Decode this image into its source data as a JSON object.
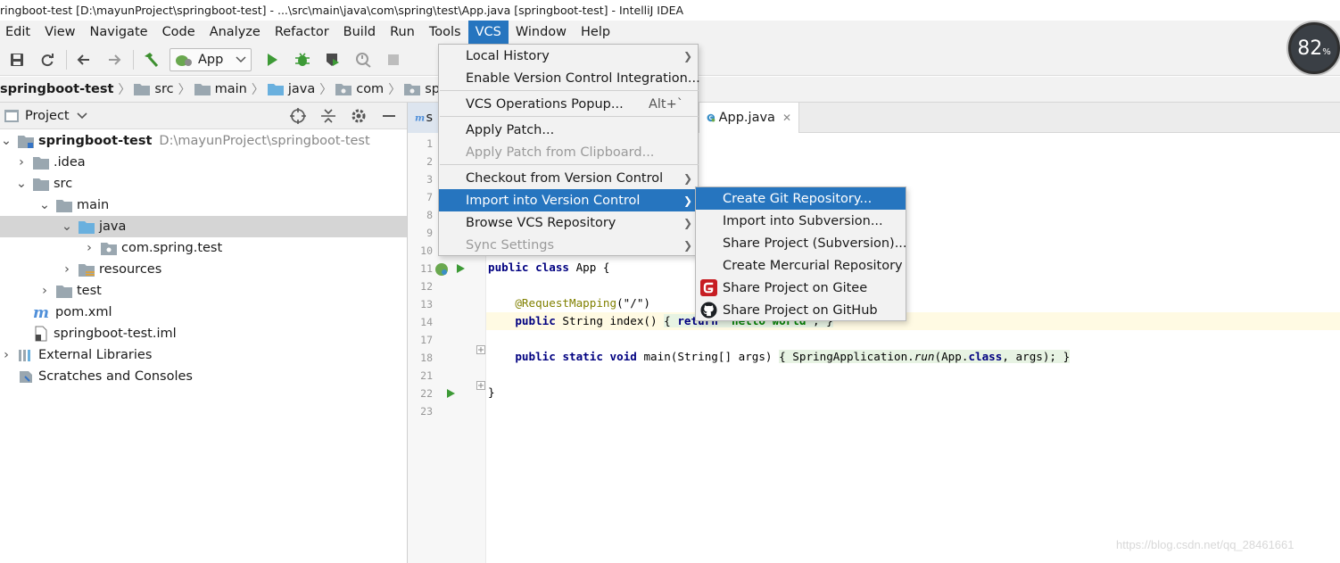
{
  "window": {
    "title": "ringboot-test [D:\\mayunProject\\springboot-test] - ...\\src\\main\\java\\com\\spring\\test\\App.java [springboot-test] - IntelliJ IDEA"
  },
  "menu_bar": [
    "Edit",
    "View",
    "Navigate",
    "Code",
    "Analyze",
    "Refactor",
    "Build",
    "Run",
    "Tools",
    "VCS",
    "Window",
    "Help"
  ],
  "toolbar": {
    "run_config": "App",
    "icons": [
      "save-icon",
      "sync-icon",
      "back-icon",
      "forward-icon",
      "build-hammer-icon",
      "run-icon",
      "debug-icon",
      "coverage-icon",
      "profile-icon",
      "stop-icon"
    ]
  },
  "breadcrumb": [
    "springboot-test",
    "src",
    "main",
    "java",
    "com",
    "spring"
  ],
  "project_panel": {
    "title": "Project",
    "tree": [
      {
        "label": "springboot-test",
        "path": "D:\\mayunProject\\springboot-test"
      },
      {
        "label": ".idea"
      },
      {
        "label": "src"
      },
      {
        "label": "main"
      },
      {
        "label": "java"
      },
      {
        "label": "com.spring.test"
      },
      {
        "label": "resources"
      },
      {
        "label": "test"
      },
      {
        "label": "pom.xml"
      },
      {
        "label": "springboot-test.iml"
      },
      {
        "label": "External Libraries"
      },
      {
        "label": "Scratches and Consoles"
      }
    ]
  },
  "editor": {
    "tabs": [
      {
        "label": "s"
      },
      {
        "label": "App.java"
      }
    ],
    "line_numbers": [
      "1",
      "2",
      "3",
      "7",
      "8",
      "9",
      "10",
      "11",
      "12",
      "13",
      "14",
      "17",
      "18",
      "21",
      "22",
      "23"
    ],
    "code": {
      "l11_kw1": "public",
      "l11_kw2": "class",
      "l11_rest": " App {",
      "l13_ann": "@RequestMapping",
      "l13_rest": "(\"/\")",
      "l14_kw": "public",
      "l14_mid": " String index() ",
      "l14_fold_open": "{ ",
      "l14_ret": "return",
      "l14_str": " \"hello world\"",
      "l14_end": "; }",
      "l18_kw1": "public",
      "l18_kw2": "static",
      "l18_kw3": "void",
      "l18_mid": " main(String[] args) ",
      "l18_fold_open": "{ ",
      "l18_call": "SpringApplication.",
      "l18_run": "run",
      "l18_args": "(App.",
      "l18_class_kw": "class",
      "l18_end": ", args); }",
      "l22": "}"
    }
  },
  "vcs_menu": {
    "items": [
      {
        "label": "Local History",
        "submenu": true
      },
      {
        "label": "Enable Version Control Integration..."
      },
      {
        "label": "VCS Operations Popup...",
        "shortcut": "Alt+`"
      },
      {
        "label": "Apply Patch..."
      },
      {
        "label": "Apply Patch from Clipboard...",
        "disabled": true
      },
      {
        "label": "Checkout from Version Control",
        "submenu": true
      },
      {
        "label": "Import into Version Control",
        "submenu": true,
        "highlighted": true
      },
      {
        "label": "Browse VCS Repository",
        "submenu": true
      },
      {
        "label": "Sync Settings",
        "submenu": true,
        "disabled": true
      }
    ]
  },
  "import_submenu": {
    "items": [
      {
        "label": "Create Git Repository...",
        "highlighted": true
      },
      {
        "label": "Import into Subversion..."
      },
      {
        "label": "Share Project (Subversion)..."
      },
      {
        "label": "Create Mercurial Repository"
      },
      {
        "label": "Share Project on Gitee",
        "icon": "gitee-icon"
      },
      {
        "label": "Share Project on GitHub",
        "icon": "github-icon"
      }
    ]
  },
  "cpu_badge": {
    "value": "82",
    "unit": "%"
  },
  "watermark": "https://blog.csdn.net/qq_28461661",
  "colors": {
    "accent": "#2675bf",
    "menu_bg": "#f2f2f2",
    "gitee_red": "#c71d23"
  }
}
